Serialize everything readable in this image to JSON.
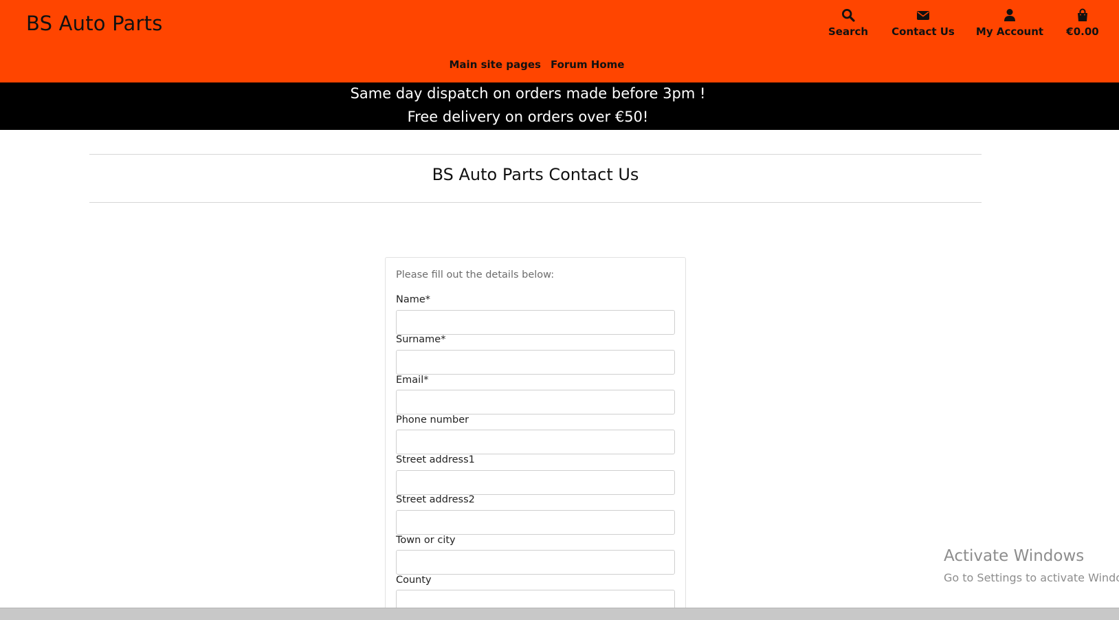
{
  "header": {
    "brand": "BS Auto Parts",
    "nav": {
      "search": "Search",
      "contact": "Contact Us",
      "account": "My Account",
      "bag_total": "€0.00"
    },
    "subnav": [
      "Main site pages",
      "Forum Home"
    ],
    "background_color": "#ff4500"
  },
  "banner": {
    "line1": "Same day dispatch on orders made before 3pm !",
    "line2": "Free delivery on orders over €50!",
    "background_color": "#000000"
  },
  "page": {
    "title": "BS Auto Parts Contact Us"
  },
  "form": {
    "intro": "Please fill out the details below:",
    "fields": [
      {
        "label": "Name*",
        "value": ""
      },
      {
        "label": "Surname*",
        "value": ""
      },
      {
        "label": "Email*",
        "value": ""
      },
      {
        "label": "Phone number",
        "value": ""
      },
      {
        "label": "Street address1",
        "value": ""
      },
      {
        "label": "Street address2",
        "value": ""
      },
      {
        "label": "Town or city",
        "value": ""
      },
      {
        "label": "County",
        "value": ""
      }
    ]
  },
  "watermark": {
    "title": "Activate Windows",
    "subtitle": "Go to Settings to activate Windo"
  },
  "icons": {
    "search": "search-icon",
    "contact": "envelope-icon",
    "account": "user-icon",
    "bag": "shopping-bag-icon"
  }
}
